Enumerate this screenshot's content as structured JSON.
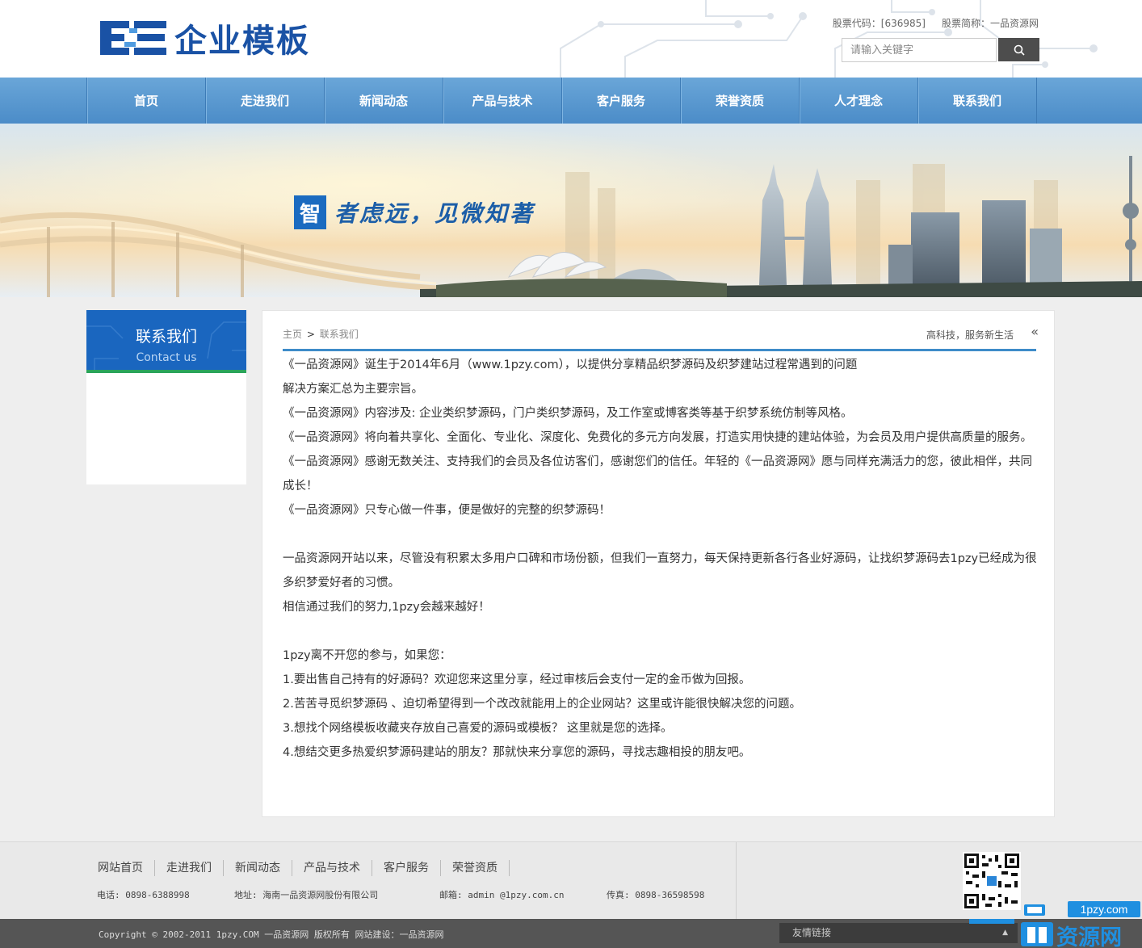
{
  "header": {
    "logo_text": "企业模板",
    "stock_code": "股票代码：[636985]",
    "stock_name": "股票简称：一品资源网",
    "search_placeholder": "请输入关键字"
  },
  "nav": {
    "items": [
      "首页",
      "走进我们",
      "新闻动态",
      "产品与技术",
      "客户服务",
      "荣誉资质",
      "人才理念",
      "联系我们"
    ]
  },
  "banner": {
    "slogan_char": "智",
    "slogan_rest": "者虑远，见微知著"
  },
  "sidebar": {
    "title": "联系我们",
    "subtitle": "Contact us"
  },
  "main": {
    "crumb_home": "主页",
    "crumb_sep": ">",
    "crumb_current": "联系我们",
    "motto": "高科技，服务新生活",
    "paragraphs": [
      "《一品资源网》诞生于2014年6月（www.1pzy.com），以提供分享精品织梦源码及织梦建站过程常遇到的问题",
      "解决方案汇总为主要宗旨。",
      "《一品资源网》内容涉及: 企业类织梦源码，门户类织梦源码，及工作室或博客类等基于织梦系统仿制等风格。",
      "《一品资源网》将向着共享化、全面化、专业化、深度化、免费化的多元方向发展，打造实用快捷的建站体验，为会员及用户提供高质量的服务。",
      "《一品资源网》感谢无数关注、支持我们的会员及各位访客们，感谢您们的信任。年轻的《一品资源网》愿与同样充满活力的您，彼此相伴，共同成长！",
      "《一品资源网》只专心做一件事，便是做好的完整的织梦源码！",
      "",
      "一品资源网开站以来，尽管没有积累太多用户口碑和市场份额，但我们一直努力，每天保持更新各行各业好源码，让找织梦源码去1pzy已经成为很多织梦爱好者的习惯。",
      "相信通过我们的努力,1pzy会越来越好！",
      "",
      "1pzy离不开您的参与，如果您：",
      "1.要出售自己持有的好源码？欢迎您来这里分享，经过审核后会支付一定的金币做为回报。",
      "2.苦苦寻觅织梦源码 、迫切希望得到一个改改就能用上的企业网站？这里或许能很快解决您的问题。",
      "3.想找个网络模板收藏夹存放自己喜爱的源码或模板？ 这里就是您的选择。",
      "4.想结交更多热爱织梦源码建站的朋友？那就快来分享您的源码，寻找志趣相投的朋友吧。"
    ]
  },
  "footer": {
    "links": [
      "网站首页",
      "走进我们",
      "新闻动态",
      "产品与技术",
      "客户服务",
      "荣誉资质"
    ],
    "phone": "电话: 0898-6388998",
    "address": "地址: 海南一品资源网股份有限公司",
    "email": "邮箱: admin @1pzy.com.cn",
    "fax": "传真: 0898-36598598",
    "copyright": "Copyright © 2002-2011 1pzy.COM 一品资源网 版权所有  网站建设：一品资源网",
    "friend_links": "友情链接"
  },
  "watermark": {
    "domain": "1pzy.com",
    "name": "资源网"
  },
  "colors": {
    "brand": "#1a52a5",
    "nav": "#5a9bd2",
    "accent_line": "#3e8cc9",
    "sidebar_head": "#1a66bf"
  }
}
